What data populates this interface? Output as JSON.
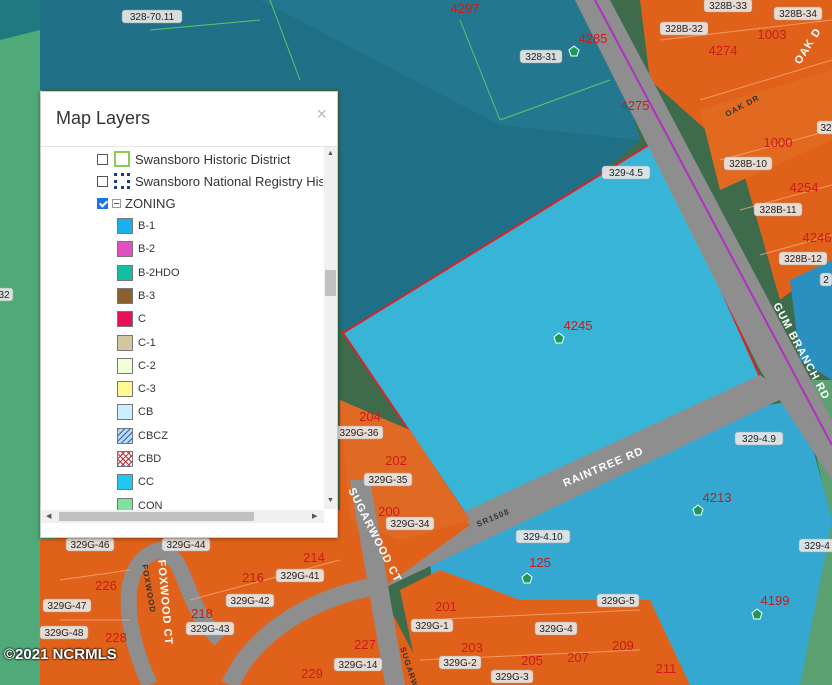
{
  "panel": {
    "title": "Map Layers",
    "close_icon": "×",
    "layers": [
      {
        "label": "Swansboro Historic District",
        "checked": false
      },
      {
        "label": "Swansboro National Registry His",
        "checked": false
      },
      {
        "label": "ZONING",
        "checked": true
      }
    ],
    "zoning_legend": [
      {
        "code": "B-1",
        "color": "#1ab0f0"
      },
      {
        "code": "B-2",
        "color": "#e050c0"
      },
      {
        "code": "B-2HDO",
        "color": "#10c0a0"
      },
      {
        "code": "B-3",
        "color": "#8b6030"
      },
      {
        "code": "C",
        "color": "#e8105a"
      },
      {
        "code": "C-1",
        "color": "#d2c8a0"
      },
      {
        "code": "C-2",
        "color": "#f0ffd8"
      },
      {
        "code": "C-3",
        "color": "#fff890"
      },
      {
        "code": "CB",
        "color": "#cceeff"
      },
      {
        "code": "CBCZ",
        "color": "#b8dcff"
      },
      {
        "code": "CBD",
        "color": "#ffffff"
      },
      {
        "code": "CC",
        "color": "#20c8f0"
      },
      {
        "code": "CON",
        "color": "#80e0a0"
      }
    ]
  },
  "parcels": [
    {
      "id": "328-70.11"
    },
    {
      "id": "328-31"
    },
    {
      "id": "328B-33"
    },
    {
      "id": "328B-34"
    },
    {
      "id": "328B-32"
    },
    {
      "id": "328B-10"
    },
    {
      "id": "328B-11"
    },
    {
      "id": "328B-12"
    },
    {
      "id": "329-4.5"
    },
    {
      "id": "329G-36"
    },
    {
      "id": "329G-35"
    },
    {
      "id": "329G-34"
    },
    {
      "id": "329-4.9"
    },
    {
      "id": "329-4.10"
    },
    {
      "id": "329G-46"
    },
    {
      "id": "329G-44"
    },
    {
      "id": "329G-41"
    },
    {
      "id": "329G-42"
    },
    {
      "id": "329G-47"
    },
    {
      "id": "329G-43"
    },
    {
      "id": "329G-48"
    },
    {
      "id": "329G-14"
    },
    {
      "id": "329G-1"
    },
    {
      "id": "329G-4"
    },
    {
      "id": "329G-5"
    },
    {
      "id": "329G-2"
    },
    {
      "id": "329G-3"
    },
    {
      "id": "329-4"
    },
    {
      "id": "32"
    },
    {
      "id": "32"
    },
    {
      "id": "2"
    }
  ],
  "addresses": [
    "4297",
    "4285",
    "4274",
    "1003",
    "4275",
    "1000",
    "4254",
    "4246",
    "4245",
    "204",
    "202",
    "200",
    "4213",
    "125",
    "4199",
    "214",
    "216",
    "226",
    "218",
    "228",
    "227",
    "229",
    "201",
    "203",
    "205",
    "207",
    "209",
    "211"
  ],
  "roads": {
    "gum_branch": "GUM BRANCH RD",
    "raintree": "RAINTREE RD",
    "sugarwood": "SUGARWOOD CT",
    "foxwood": "FOXWOOD CT",
    "foxwood_small": "FOXWOOD",
    "oak": "OAK D",
    "oak_small": "OAK DR",
    "sr": "SR1508",
    "sugarwood_small": "SUGARW"
  },
  "copyright": "©2021 NCRMLS"
}
